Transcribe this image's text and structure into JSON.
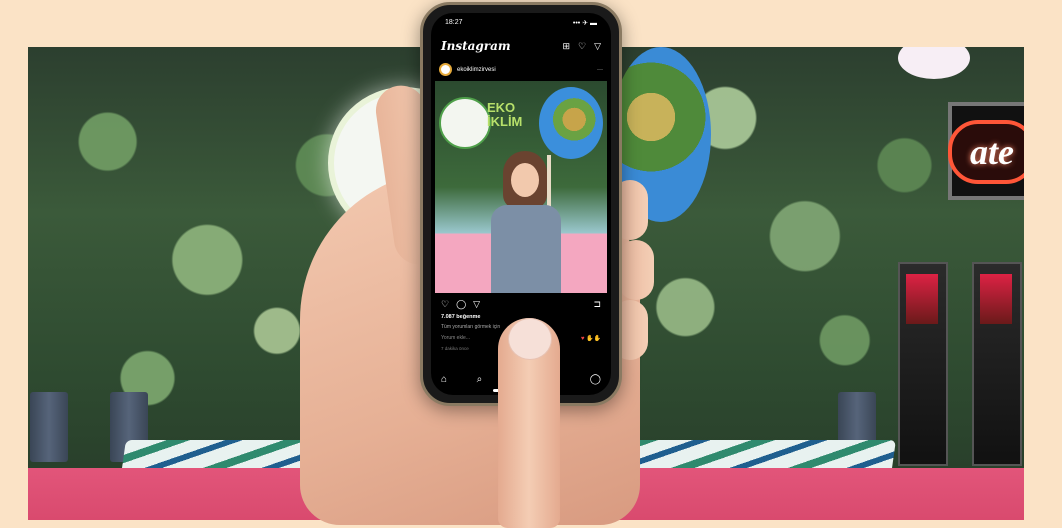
{
  "background": {
    "neon_sign_text": "ate"
  },
  "phone": {
    "status": {
      "time": "18:27",
      "right": "••• ✈ ▬"
    },
    "app": {
      "brand": "Instagram",
      "icons": [
        "plus-square-icon",
        "heart-icon",
        "send-icon"
      ]
    },
    "post": {
      "username": "ekoiklimzirvesi",
      "more": "···",
      "photo_text": "EKO\nİKLİM",
      "actions": {
        "like": "♡",
        "comment": "◯",
        "share": "▽",
        "save": "⊐"
      },
      "likes": "7.087 beğenme",
      "caption": "Tüm yorumları görmek için",
      "comment_placeholder": "Yorum ekle...",
      "reactions": "♥ ✋✋",
      "time": "7 dakika önce"
    },
    "nav": {
      "home": "⌂",
      "search": "⌕",
      "reels": "▣",
      "shop": "◫",
      "profile": "◯"
    }
  },
  "colors": {
    "page_bg": "#fbe3c6",
    "floor": "#e2557a",
    "neon": "#ff5638"
  }
}
